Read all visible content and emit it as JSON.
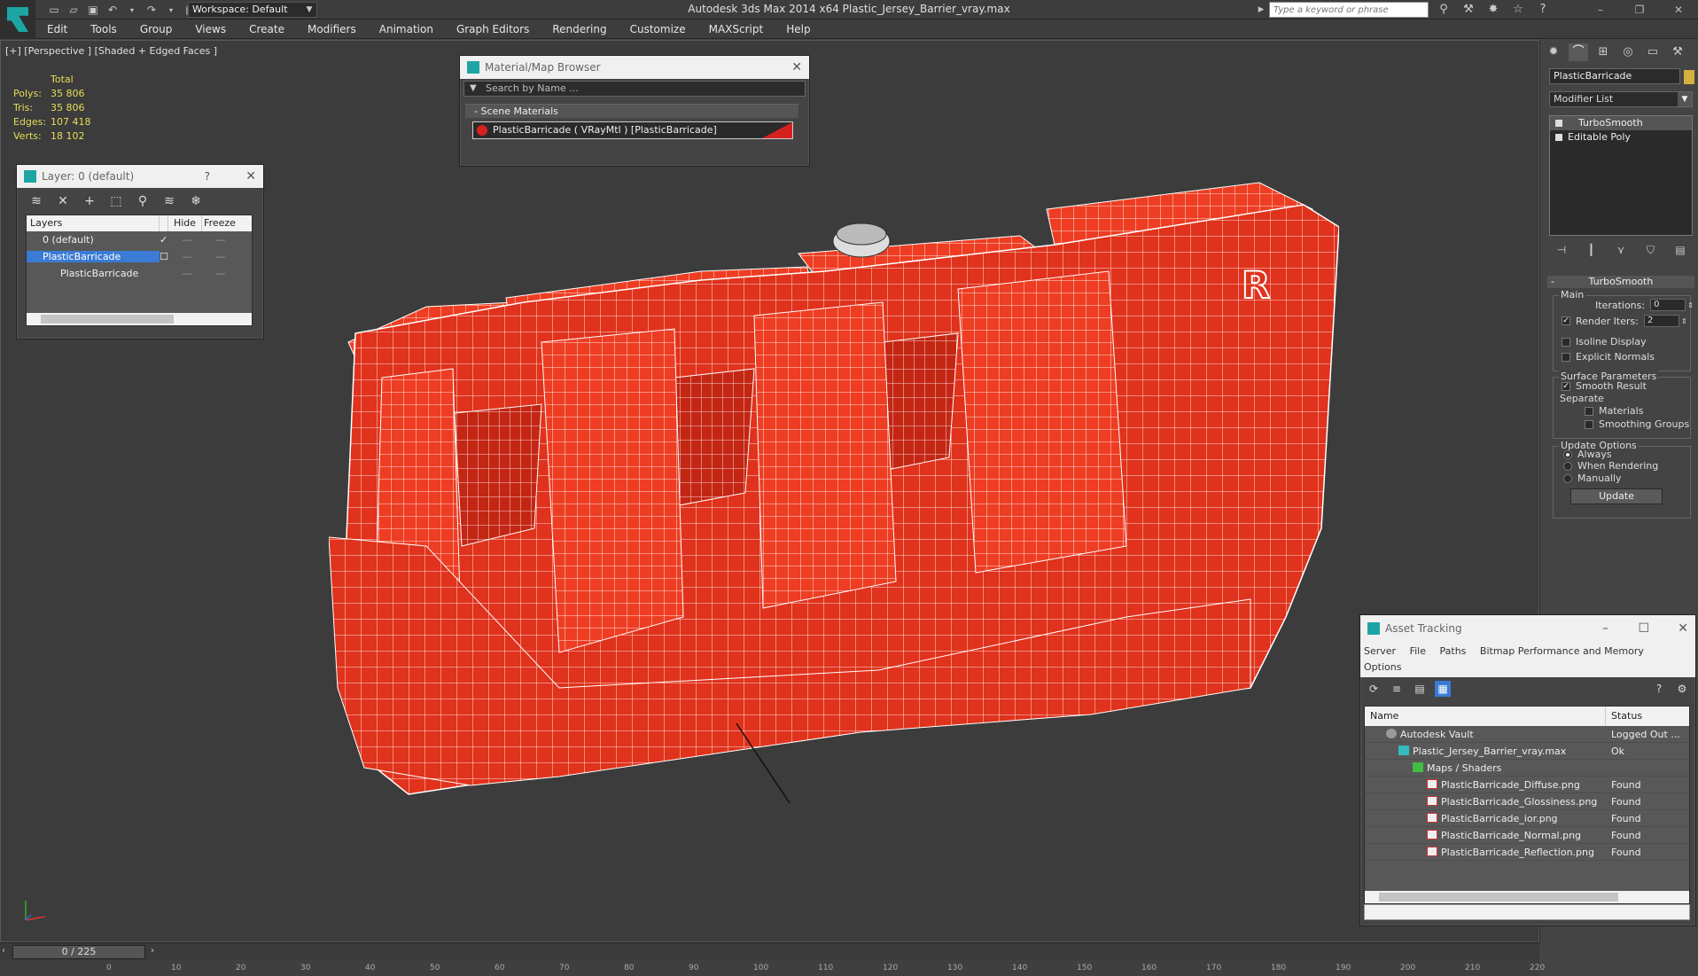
{
  "titlebar": {
    "workspace": "Workspace: Default",
    "app_title": "Autodesk 3ds Max  2014 x64      Plastic_Jersey_Barrier_vray.max",
    "search_placeholder": "Type a keyword or phrase"
  },
  "menu": [
    "Edit",
    "Tools",
    "Group",
    "Views",
    "Create",
    "Modifiers",
    "Animation",
    "Graph Editors",
    "Rendering",
    "Customize",
    "MAXScript",
    "Help"
  ],
  "viewport": {
    "label": "[+] [Perspective ] [Shaded + Edged Faces ]",
    "stats": {
      "header": "Total",
      "rows": [
        {
          "k": "Polys:",
          "v": "35 806"
        },
        {
          "k": "Tris:",
          "v": "35 806"
        },
        {
          "k": "Edges:",
          "v": "107 418"
        },
        {
          "k": "Verts:",
          "v": "18 102"
        }
      ]
    },
    "barrier_letter": "R"
  },
  "layer_panel": {
    "title": "Layer: 0 (default)",
    "help": "?",
    "columns": {
      "layers": "Layers",
      "hide": "Hide",
      "freeze": "Freeze"
    },
    "rows": [
      {
        "name": "0 (default)"
      },
      {
        "name": "PlasticBarricade"
      },
      {
        "name": "PlasticBarricade"
      }
    ]
  },
  "material_browser": {
    "title": "Material/Map Browser",
    "search_placeholder": "Search by Name ...",
    "section": "- Scene Materials",
    "item": "PlasticBarricade  ( VRayMtl )  [PlasticBarricade]"
  },
  "command_panel": {
    "object_name": "PlasticBarricade",
    "modifier_list": "Modifier List",
    "stack": [
      "TurboSmooth",
      "Editable Poly"
    ],
    "rollout": "TurboSmooth",
    "main_group": "Main",
    "iterations_label": "Iterations:",
    "iterations": "0",
    "render_iters_label": "Render Iters:",
    "render_iters": "2",
    "isoline": "Isoline Display",
    "explicit_normals": "Explicit Normals",
    "surface_group": "Surface Parameters",
    "smooth_result": "Smooth Result",
    "separate": "Separate",
    "materials": "Materials",
    "smoothing_groups": "Smoothing Groups",
    "update_group": "Update Options",
    "always": "Always",
    "when_rendering": "When Rendering",
    "manually": "Manually",
    "update_button": "Update"
  },
  "asset_tracking": {
    "title": "Asset Tracking",
    "menu": [
      "Server",
      "File",
      "Paths",
      "Bitmap Performance and Memory",
      "Options"
    ],
    "columns": {
      "name": "Name",
      "status": "Status"
    },
    "rows": [
      {
        "name": "Autodesk Vault",
        "status": "Logged Out ...",
        "indent": 1,
        "icon": "vault"
      },
      {
        "name": "Plastic_Jersey_Barrier_vray.max",
        "status": "Ok",
        "indent": 2,
        "icon": "max"
      },
      {
        "name": "Maps / Shaders",
        "status": "",
        "indent": 3,
        "icon": "folder"
      },
      {
        "name": "PlasticBarricade_Diffuse.png",
        "status": "Found",
        "indent": 4,
        "icon": "png"
      },
      {
        "name": "PlasticBarricade_Glossiness.png",
        "status": "Found",
        "indent": 4,
        "icon": "png"
      },
      {
        "name": "PlasticBarricade_ior.png",
        "status": "Found",
        "indent": 4,
        "icon": "png"
      },
      {
        "name": "PlasticBarricade_Normal.png",
        "status": "Found",
        "indent": 4,
        "icon": "png"
      },
      {
        "name": "PlasticBarricade_Reflection.png",
        "status": "Found",
        "indent": 4,
        "icon": "png"
      }
    ]
  },
  "timeline": {
    "position": "0 / 225",
    "ticks": [
      "0",
      "10",
      "20",
      "30",
      "40",
      "50",
      "60",
      "70",
      "80",
      "90",
      "100",
      "110",
      "120",
      "130",
      "140",
      "150",
      "160",
      "170",
      "180",
      "190",
      "200",
      "210",
      "220"
    ]
  },
  "colors": {
    "model_red": "#e0321c",
    "wire": "#ffffff",
    "accent": "#1da5a3",
    "selection": "#3a7bd5",
    "stats_yellow": "#e5dd57"
  }
}
